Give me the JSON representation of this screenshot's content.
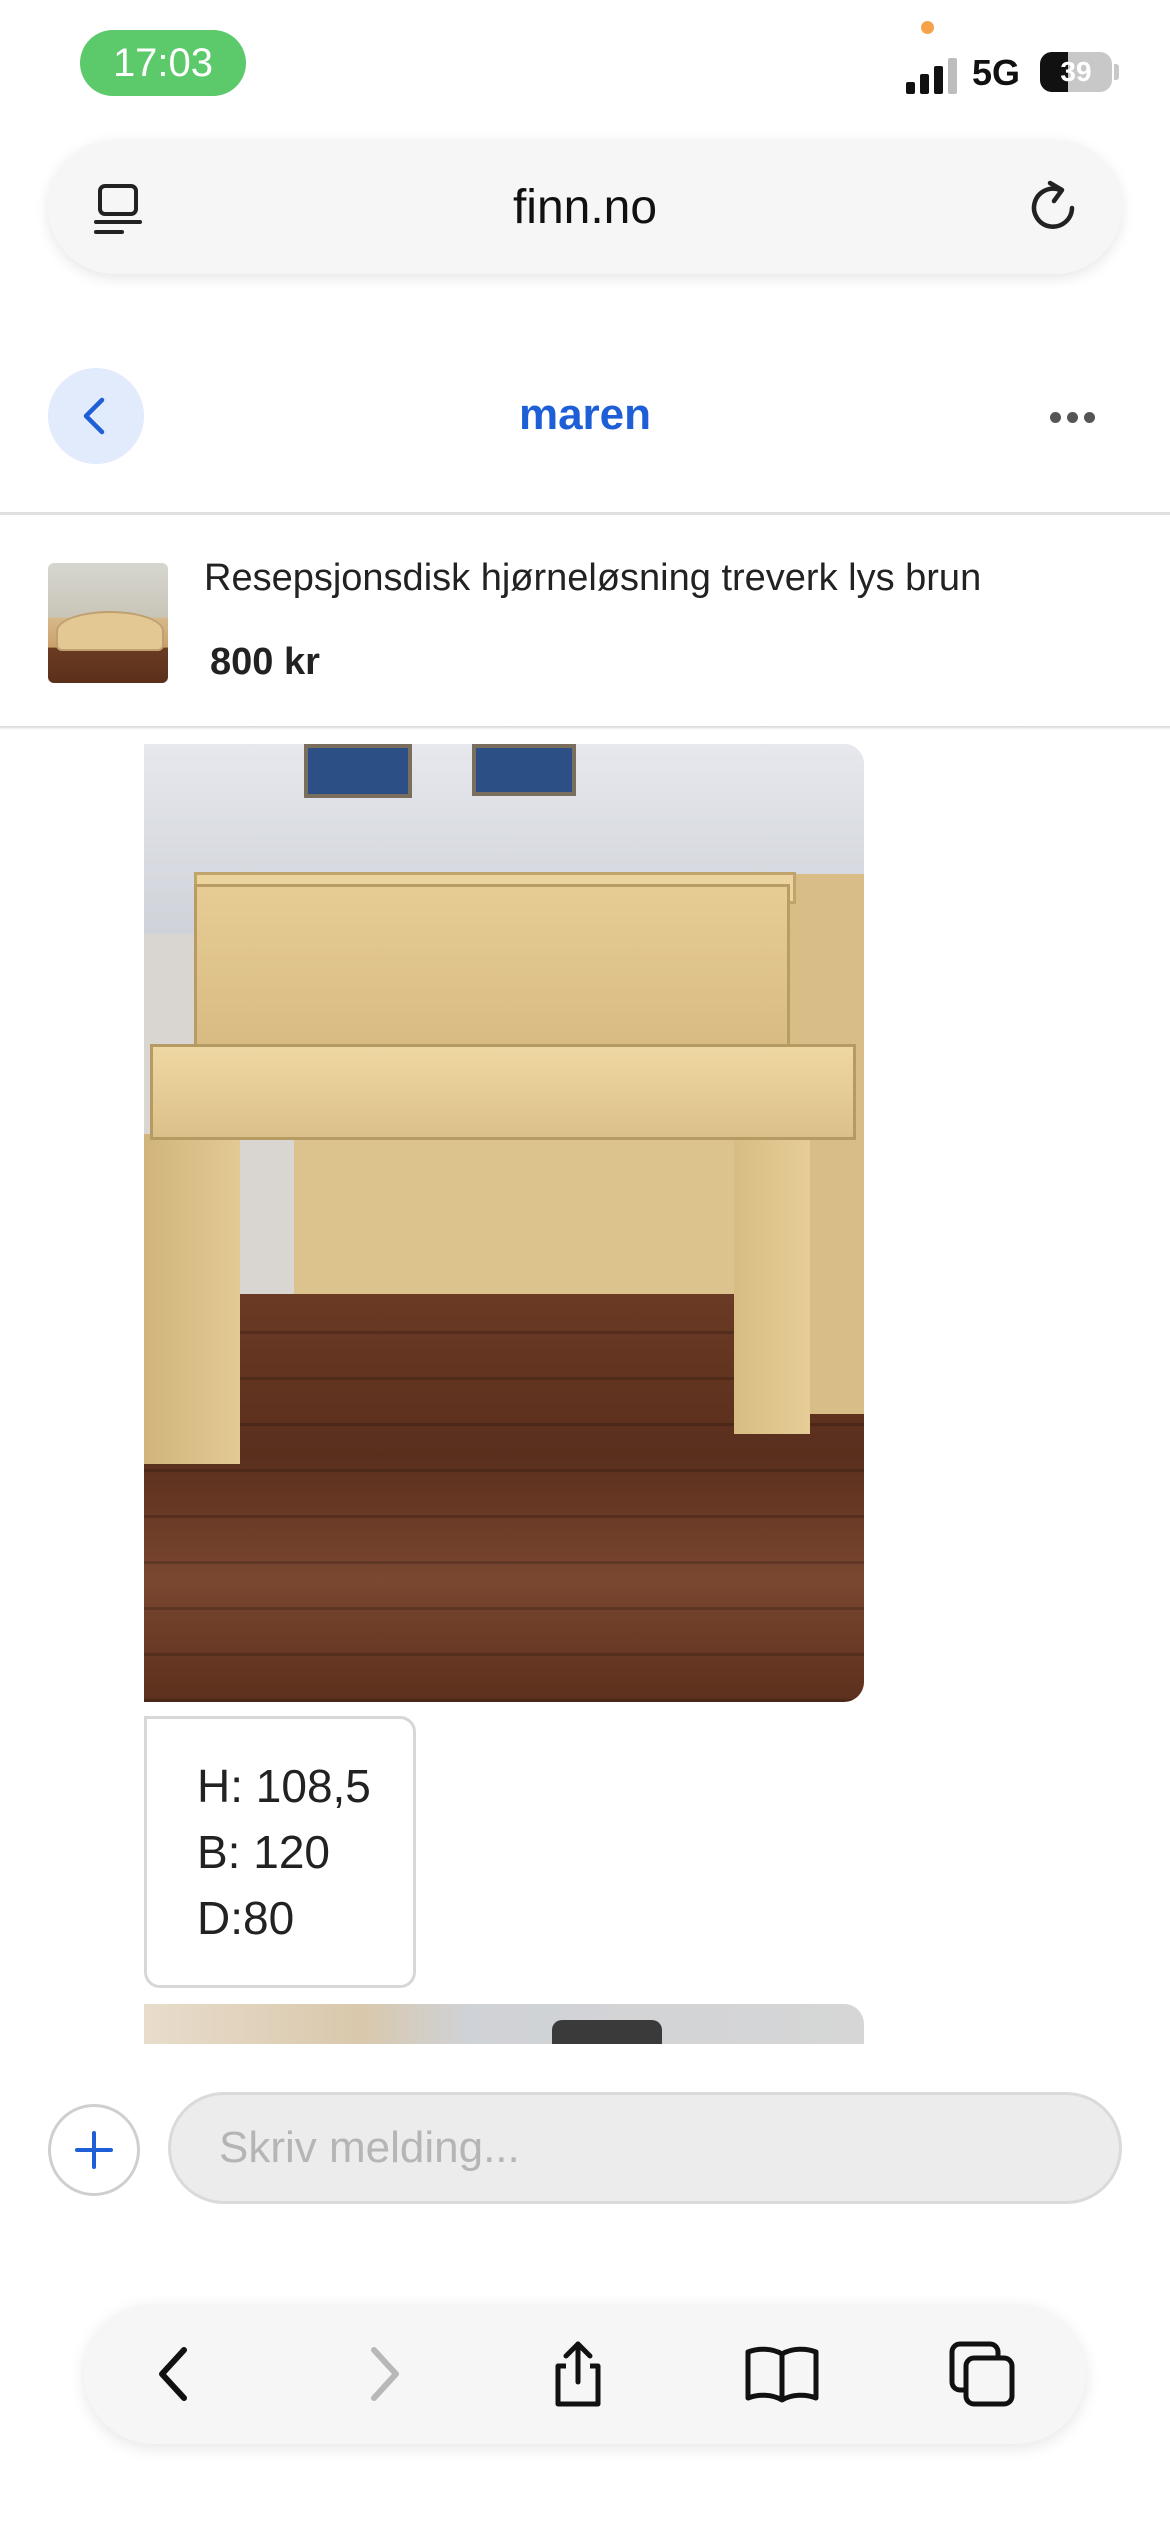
{
  "status_bar": {
    "time": "17:03",
    "network": "5G",
    "battery": "39",
    "battery_level": 0.39,
    "signal_bars_active": 3
  },
  "browser": {
    "url": "finn.no",
    "reader_icon": "reader-icon",
    "reload_icon": "reload-icon"
  },
  "chat_header": {
    "name": "maren",
    "back_icon": "chevron-left-icon",
    "more_icon": "ellipsis-icon"
  },
  "listing": {
    "title": "Resepsjonsdisk hjørneløsning treverk lys brun",
    "price": "800 kr"
  },
  "messages": {
    "dimensions": [
      "H: 108,5",
      "B: 120",
      "D:80"
    ]
  },
  "composer": {
    "placeholder": "Skriv melding...",
    "add_icon": "plus-icon"
  },
  "toolbar": {
    "icons": [
      "back-icon",
      "forward-icon",
      "share-icon",
      "bookmarks-icon",
      "tabs-icon"
    ]
  },
  "colors": {
    "accent": "#1e5fd8",
    "status_time_bg": "#5cc96b",
    "back_button_bg": "#e1ebfb"
  }
}
